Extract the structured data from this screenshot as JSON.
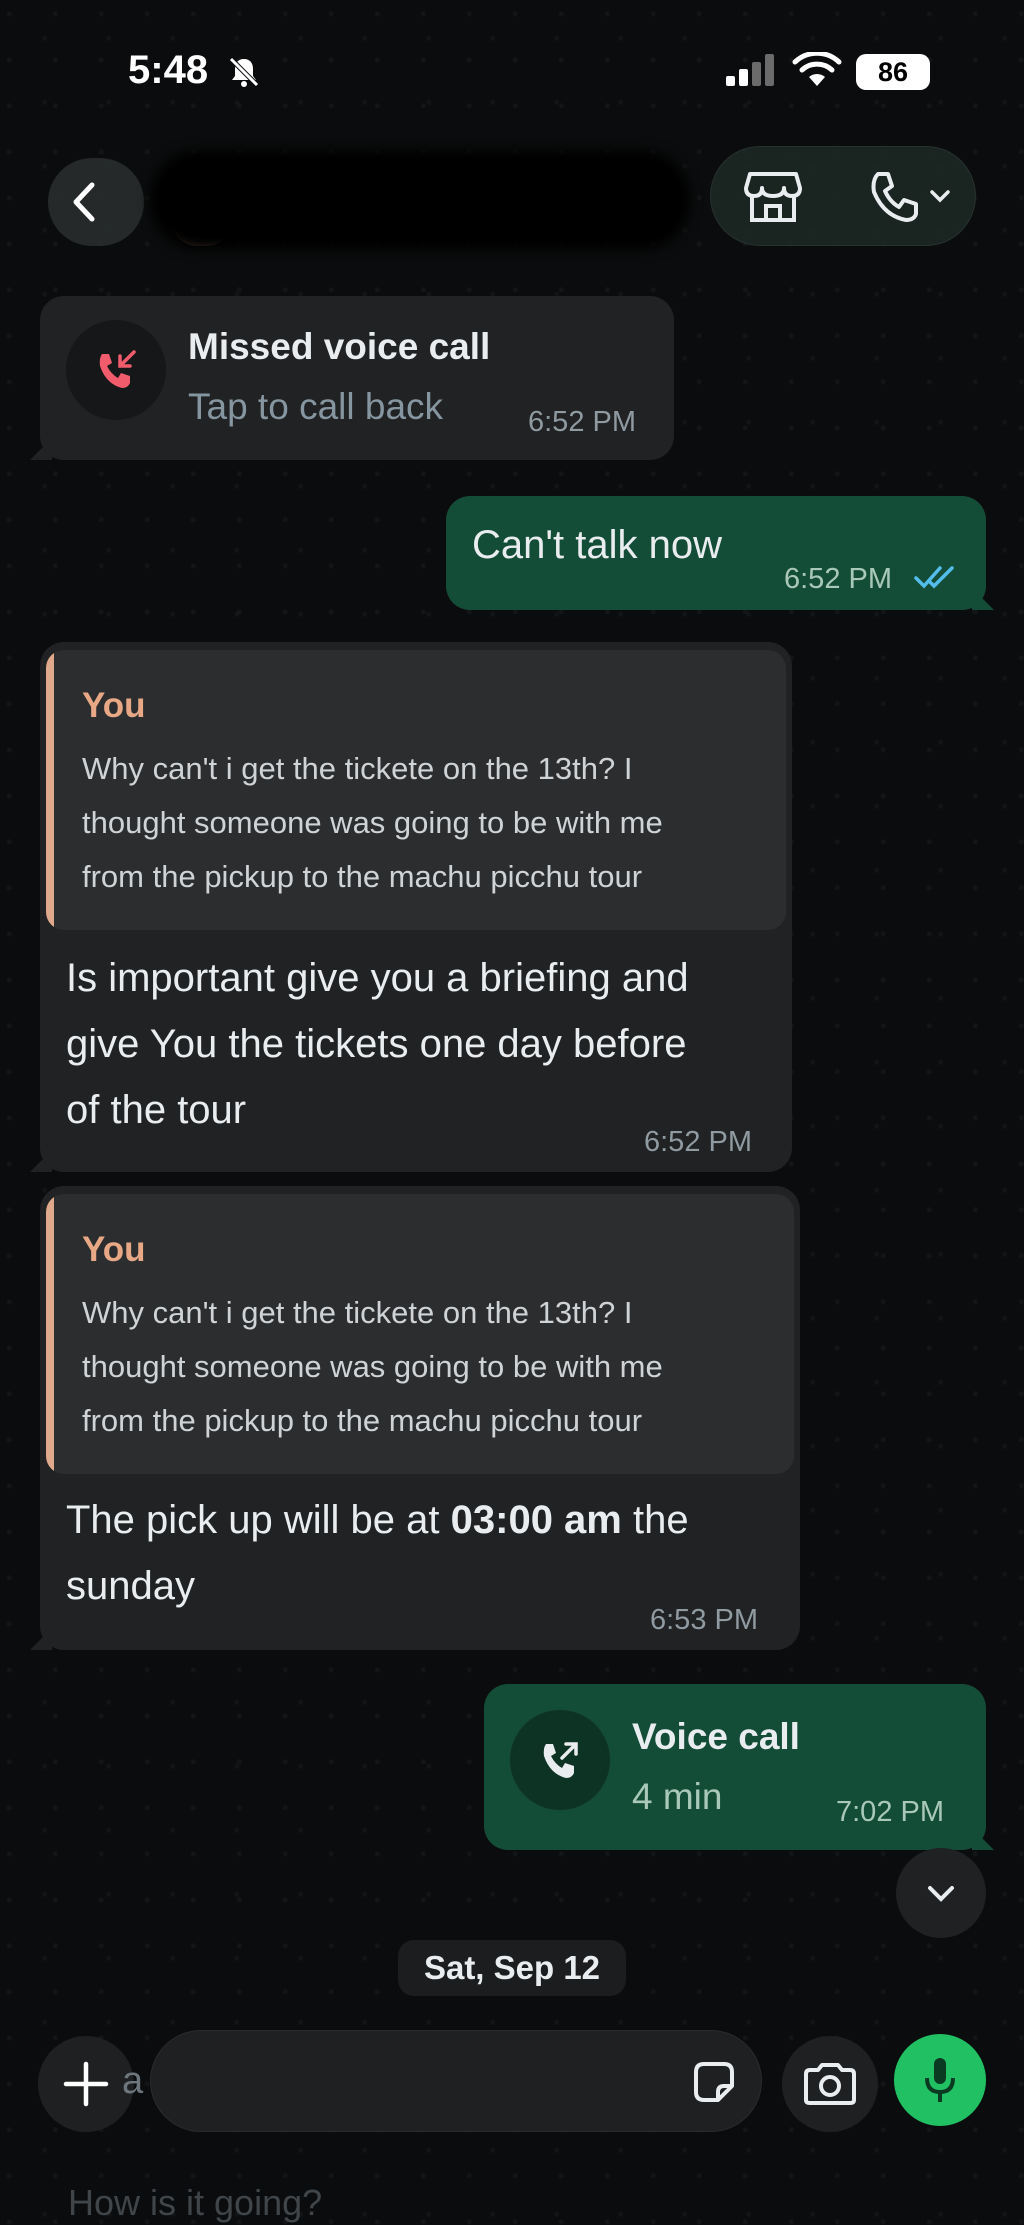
{
  "status_bar": {
    "time": "5:48",
    "battery": "86",
    "icons": [
      "bell-slash-icon",
      "signal-icon",
      "wifi-icon",
      "battery-icon"
    ]
  },
  "header": {
    "icons": [
      "back-icon",
      "store-icon",
      "phone-icon",
      "chevron-down-icon"
    ]
  },
  "messages": {
    "missed_call": {
      "title": "Missed voice call",
      "subtitle": "Tap to call back",
      "time": "6:52 PM"
    },
    "cant_talk": {
      "text": "Can't talk now",
      "time": "6:52 PM"
    },
    "reply1": {
      "quote_author": "You",
      "quote_lines": [
        "Why can't i get the tickete on the 13th? I",
        "thought someone was going to be with me",
        "from the pickup to the machu picchu tour"
      ],
      "text_lines": [
        "Is important give you a briefing and",
        "give You the tickets one day before",
        "of the tour"
      ],
      "time": "6:52 PM"
    },
    "reply2": {
      "quote_author": "You",
      "quote_lines": [
        "Why can't i get the tickete on the 13th? I",
        "thought someone was going to be with me",
        "from the pickup to the machu picchu tour"
      ],
      "text_before": "The pick up will be at ",
      "text_bold": "03:00 am",
      "text_after": " the",
      "text_line2": "sunday",
      "time": "6:53 PM"
    },
    "voice_call": {
      "title": "Voice call",
      "subtitle": "4 min",
      "time": "7:02 PM"
    }
  },
  "date_chip": "Sat, Sep 12",
  "composer": {
    "ghost_text": "a",
    "suggestion": "How is it going?"
  },
  "colors": {
    "background": "#0b0c0d",
    "incoming_bubble": "#202223",
    "outgoing_bubble": "#144d37",
    "accent_green": "#21c063",
    "quote_accent": "#e8a886",
    "read_ticks": "#53bdeb",
    "missed_call_red": "#f15c6d"
  }
}
